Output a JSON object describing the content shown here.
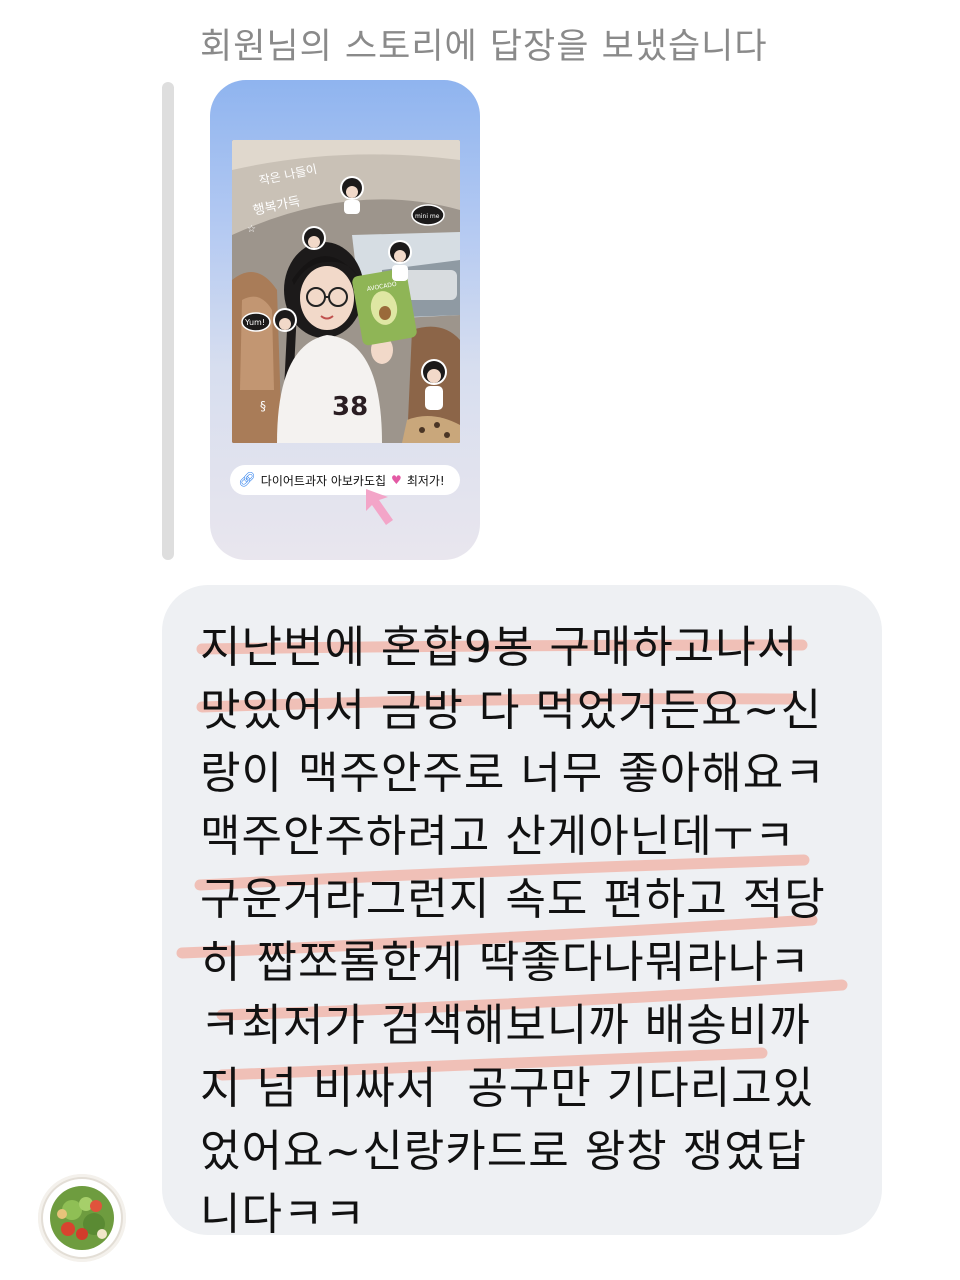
{
  "header": {
    "reply_notice": "회원님의 스토리에 답장을 보냈습니다"
  },
  "story": {
    "link_sticker_text": "다이어트과자 아보카도칩",
    "link_sticker_suffix": "최저가!",
    "link_icon": "link-icon",
    "heart_icon": "heart-icon",
    "arrow_icon": "pointer-arrow-icon",
    "photo_overlay": {
      "handwriting_line1": "작은 나들이",
      "handwriting_line2": "행복가득",
      "sticker_yum": "Yum!",
      "sticker_mini": "mini me",
      "sweater_text": "38",
      "chip_bag_label": "AVOCADO"
    }
  },
  "message": {
    "lines": [
      "지난번에 혼합9봉 구매하고나서",
      "맛있어서 금방 다 먹었거든요~신",
      "랑이 맥주안주로 너무 좋아해요ㅋ",
      "맥주안주하려고 산게아닌데ㅜㅋ",
      "구운거라그런지 속도 편하고 적당",
      "히 짭쪼롬한게 딱좋다나뭐라나ㅋ",
      "ㅋ최저가 검색해보니까 배송비까",
      "지 넘 비싸서  공구만 기다리고있",
      "었어요~신랑카드로 왕창 쟁였답",
      "니다ㅋㅋ"
    ],
    "highlight_color": "#f2a090"
  },
  "avatar": {
    "icon": "salad-avatar-icon"
  },
  "colors": {
    "bubble_bg": "#eef0f3",
    "header_text": "#8a8a8a",
    "quote_bar": "#dedede",
    "story_sky": "#8fb4ef",
    "arrow_pink": "#f3a5c8"
  }
}
